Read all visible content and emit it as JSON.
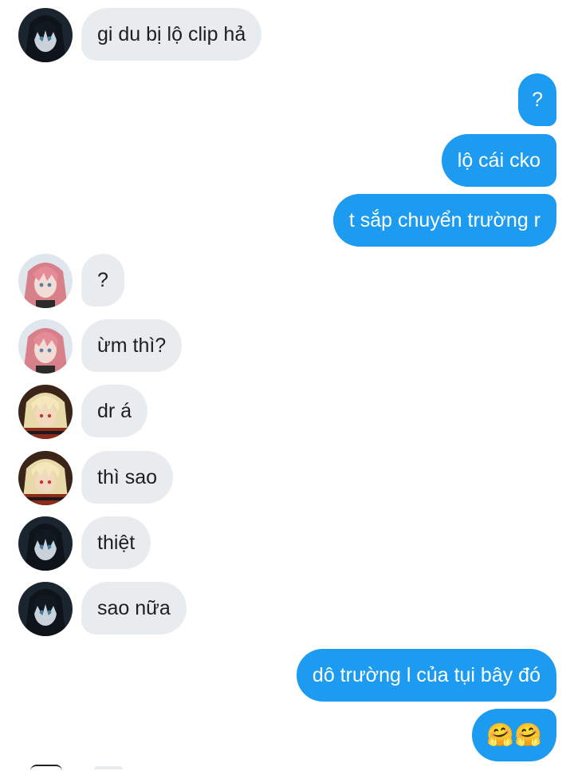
{
  "conversation": {
    "messages": [
      {
        "sender": "friend-dark",
        "text": "gi du bị lộ clip hả"
      },
      {
        "sender": "me",
        "text": "?"
      },
      {
        "sender": "me",
        "text": "lộ cái cko"
      },
      {
        "sender": "me",
        "text": "t sắp chuyển trường r"
      },
      {
        "sender": "friend-pink",
        "text": "?"
      },
      {
        "sender": "friend-pink",
        "text": "ừm thì?"
      },
      {
        "sender": "friend-blonde",
        "text": "dr á"
      },
      {
        "sender": "friend-blonde",
        "text": "thì sao"
      },
      {
        "sender": "friend-dark",
        "text": "thiệt"
      },
      {
        "sender": "friend-dark",
        "text": "sao nữa"
      },
      {
        "sender": "me",
        "text": "dô trường l của tụi bây đó"
      },
      {
        "sender": "me",
        "text": "🤗🤗"
      }
    ]
  },
  "colors": {
    "outgoing_bubble": "#1d9bf0",
    "incoming_bubble": "#e9ecef",
    "outgoing_text": "#ffffff",
    "incoming_text": "#1c1e21"
  },
  "icons": {
    "avatar_dark": "dark-haired-avatar",
    "avatar_pink": "pink-haired-avatar",
    "avatar_blonde": "blonde-haired-avatar",
    "emoji": "hugging-face-emoji"
  }
}
